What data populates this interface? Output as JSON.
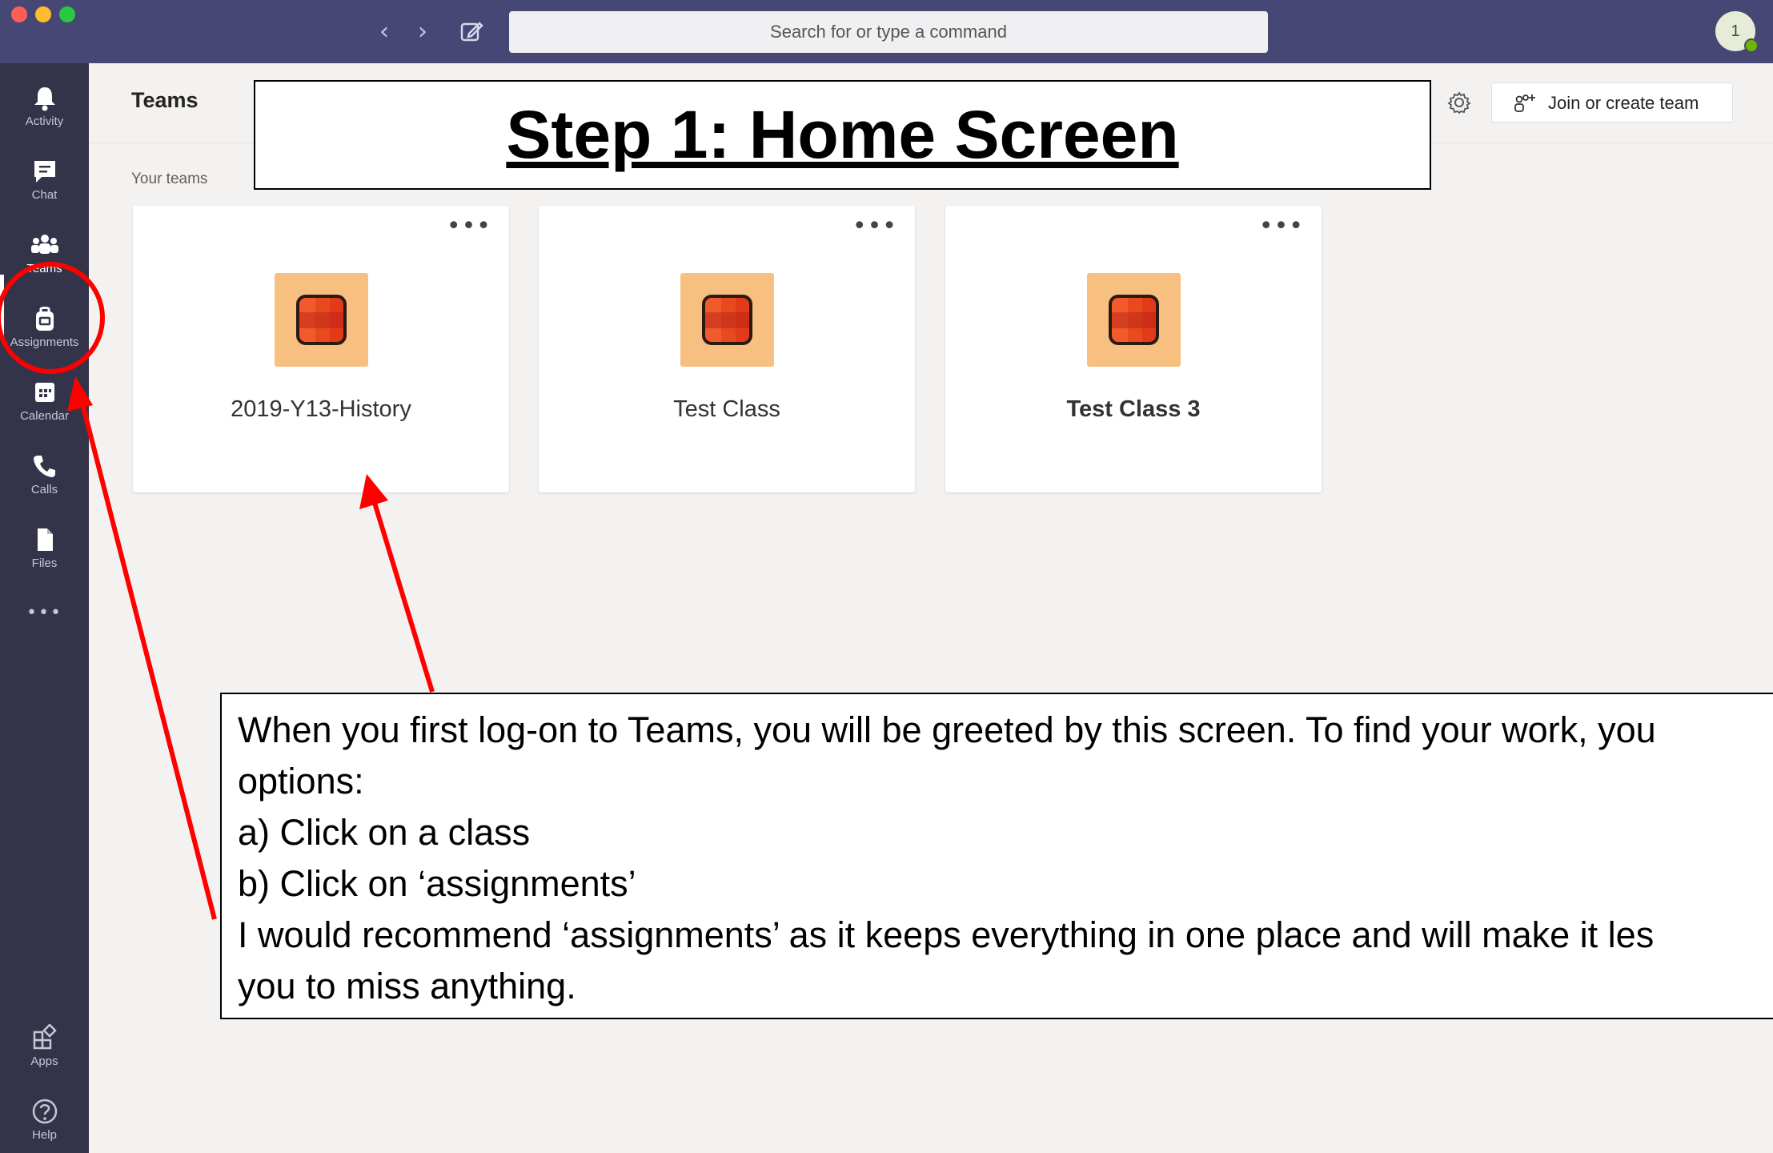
{
  "topbar": {
    "search_placeholder": "Search for or type a command",
    "avatar_initial": "1",
    "back_glyph": "‹",
    "forward_glyph": "›"
  },
  "rail": {
    "items": [
      {
        "label": "Activity",
        "icon": "bell-icon"
      },
      {
        "label": "Chat",
        "icon": "chat-icon"
      },
      {
        "label": "Teams",
        "icon": "teams-icon"
      },
      {
        "label": "Assignments",
        "icon": "assignments-icon"
      },
      {
        "label": "Calendar",
        "icon": "calendar-icon"
      },
      {
        "label": "Calls",
        "icon": "phone-icon"
      },
      {
        "label": "Files",
        "icon": "file-icon"
      },
      {
        "label": "Apps",
        "icon": "apps-icon"
      },
      {
        "label": "Help",
        "icon": "help-icon"
      }
    ],
    "more_glyph": "•••"
  },
  "header": {
    "title": "Teams",
    "join_label": "Join or create team",
    "section_label": "Your teams"
  },
  "teams": [
    {
      "name": "2019-Y13-History"
    },
    {
      "name": "Test Class"
    },
    {
      "name": "Test Class 3"
    }
  ],
  "card_more_glyph": "•••",
  "annotation": {
    "title": "Step 1: Home Screen",
    "lines": [
      "When you first log-on to Teams, you will be greeted by this screen. To find your work, you",
      "options:",
      "a) Click on a class",
      "b) Click on ‘assignments’",
      "I would recommend ‘assignments’ as it keeps everything in one place and will make it les",
      "you to miss anything."
    ]
  },
  "colors": {
    "topbar": "#464775",
    "rail": "#33344a",
    "background": "#f3f2f1",
    "annotation_red": "#ff0000",
    "team_logo_bg": "#f7c081"
  }
}
